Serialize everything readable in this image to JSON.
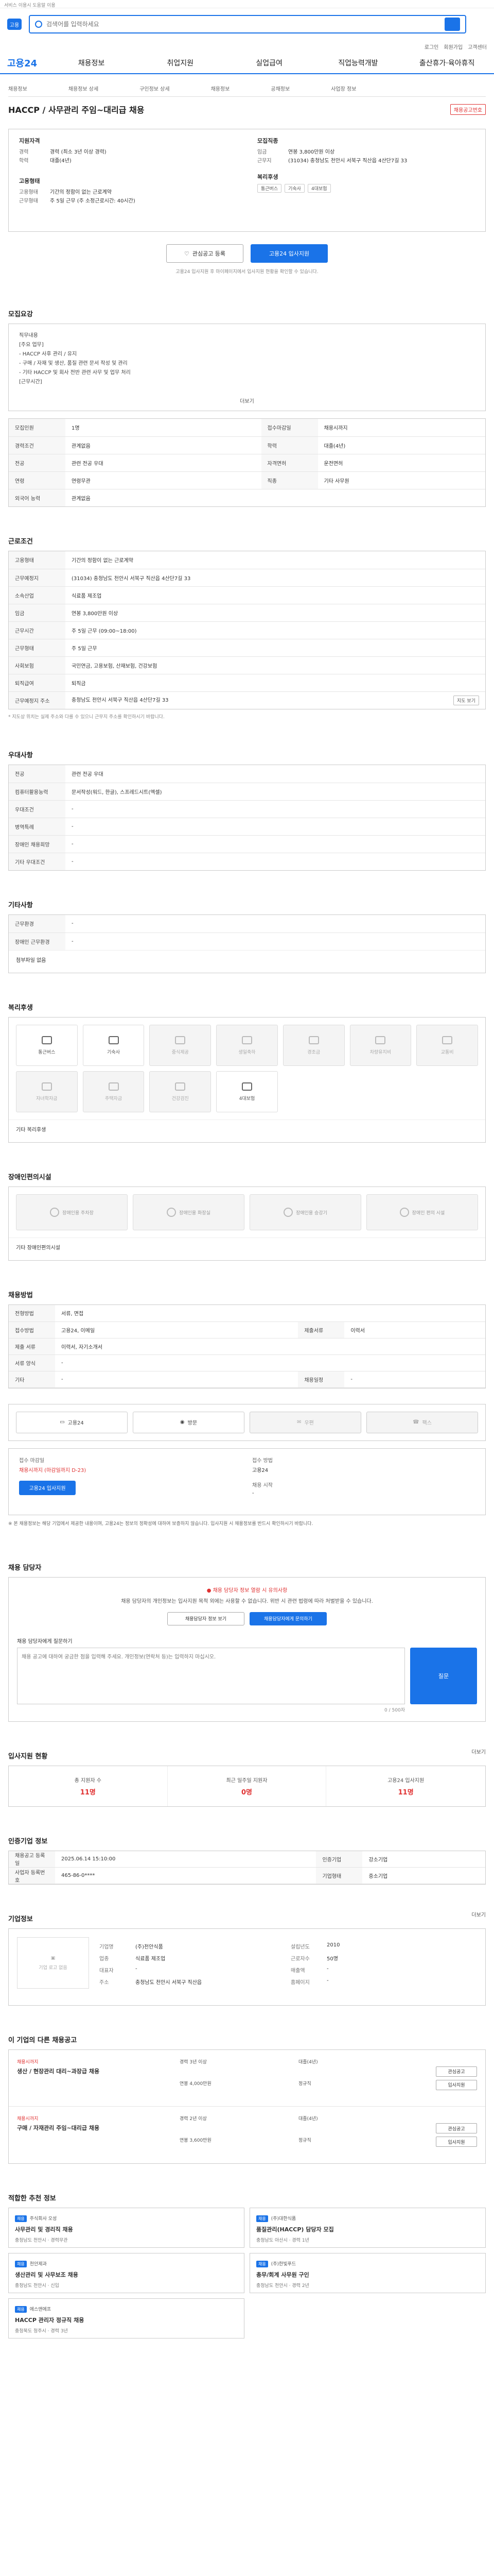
{
  "top": {
    "notice": "서비스 이용시 도움말 이용",
    "logo_text": "고용",
    "search_placeholder": "검색어를 입력하세요",
    "util_links": [
      "로그인",
      "회원가입",
      "고객센터"
    ]
  },
  "gnb": {
    "logo": "고용24",
    "items": [
      "채용정보",
      "취업지원",
      "실업급여",
      "직업능력개발",
      "출산휴가·육아휴직"
    ]
  },
  "breadcrumb": [
    "채용정보",
    "채용정보 상세",
    "구인정보 상세",
    "채용정보",
    "공채정보",
    "사업장 정보"
  ],
  "title": "HACCP / 사무관리 주임~대리급 채용",
  "scrap_badge": "채용공고번호",
  "summary": {
    "left_title": "지원자격",
    "left_rows": [
      {
        "k": "경력",
        "v": "경력 (최소 3년 이상 경력)"
      },
      {
        "k": "학력",
        "v": "대졸(4년)"
      }
    ],
    "cond_title": "고용형태",
    "cond_rows": [
      {
        "k": "고용형태",
        "v": "기간의 정함이 없는 근로계약"
      },
      {
        "k": "근무형태",
        "v": "주 5일 근무 (주 소정근로시간: 40시간)"
      }
    ],
    "right_title": "모집직종",
    "right_rows": [
      {
        "k": "임금",
        "v": "연봉 3,800만원 이상"
      },
      {
        "k": "근무지",
        "v": "(31034) 충청남도 천안시 서북구 직산읍 4산단7길 33"
      }
    ],
    "welfare_title": "복리후생",
    "chips": [
      "통근버스",
      "기숙사",
      "4대보험"
    ]
  },
  "actions": {
    "interest": "관심공고 등록",
    "apply": "고용24 입사지원",
    "note": "고용24 입사지원 후 마이페이지에서 입사지원 현황을 확인할 수 있습니다."
  },
  "sections": {
    "recruit": "모집요강",
    "work_cond": "근로조건",
    "pref": "우대사항",
    "etc": "기타사항",
    "welfare": "복리후생",
    "disability": "장애인편의시설",
    "method": "채용방법",
    "qa": "채용 담당자",
    "stats": "입사지원 현황",
    "hire": "인증기업 정보",
    "company": "기업정보",
    "other": "이 기업의 다른 채용공고",
    "recommend": "적합한 추천 정보"
  },
  "recruit": {
    "intro_lines": [
      "직무내용",
      "[주요 업무]",
      "- HACCP 사후 관리 / 유지",
      "- 구매 / 자재 및 생산, 품질 관련 문서 작성 및 관리",
      "- 기타 HACCP 및 회사 전반 관련 사무 및 업무 처리",
      "[근무시간]"
    ],
    "more": "더보기",
    "rows": [
      [
        "모집인원",
        "1명",
        "접수마감일",
        "채용시까지"
      ],
      [
        "경력조건",
        "관계없음",
        "학력",
        "대졸(4년)"
      ],
      [
        "전공",
        "관련 전공 우대",
        "자격면허",
        "운전면허"
      ],
      [
        "연령",
        "연령무관",
        "직종",
        "기타 사무원"
      ],
      [
        "외국어 능력",
        "관계없음",
        "",
        ""
      ]
    ]
  },
  "work": {
    "rows": [
      [
        "고용형태",
        "기간의 정함이 없는 근로계약"
      ],
      [
        "근무예정지",
        "(31034) 충청남도 천안시 서북구 직산읍 4산단7길 33"
      ],
      [
        "소속산업",
        "식료품 제조업"
      ],
      [
        "임금",
        "연봉 3,800만원 이상"
      ],
      [
        "근무시간",
        "주 5일 근무 (09:00~18:00)"
      ],
      [
        "근무형태",
        "주 5일 근무"
      ],
      [
        "사회보험",
        "국민연금, 고용보험, 산재보험, 건강보험"
      ],
      [
        "퇴직급여",
        "퇴직금"
      ],
      [
        "근무예정지 주소",
        "충청남도 천안시 서북구 직산읍 4산단7길 33"
      ]
    ],
    "map_btn": "지도 보기",
    "note": "* 지도상 위치는 실제 주소와 다를 수 있으니 근무지 주소를 확인하시기 바랍니다."
  },
  "pref_rows": [
    [
      "전공",
      "관련 전공 우대"
    ],
    [
      "컴퓨터활용능력",
      "문서작성(워드, 한글), 스프레드시트(엑셀)"
    ],
    [
      "우대조건",
      "-"
    ],
    [
      "병역특례",
      "-"
    ],
    [
      "장애인 채용희망",
      "-"
    ],
    [
      "기타 우대조건",
      "-"
    ]
  ],
  "etc_rows": [
    [
      "근무환경",
      "-"
    ],
    [
      "장애인 근무환경",
      "-"
    ]
  ],
  "etc_attach": "첨부파일 없음",
  "welfare": {
    "items": [
      {
        "label": "통근버스",
        "on": true
      },
      {
        "label": "기숙사",
        "on": true
      },
      {
        "label": "중식제공",
        "on": false
      },
      {
        "label": "생일축하",
        "on": false
      },
      {
        "label": "경조금",
        "on": false
      },
      {
        "label": "차량유지비",
        "on": false
      },
      {
        "label": "교통비",
        "on": false
      },
      {
        "label": "자녀학자금",
        "on": false
      },
      {
        "label": "주택자금",
        "on": false
      },
      {
        "label": "건강검진",
        "on": false
      },
      {
        "label": "4대보험",
        "on": true
      }
    ],
    "etc": "기타 복리후생"
  },
  "disability": {
    "items": [
      "장애인용 주차장",
      "장애인용 화장실",
      "장애인용 승강기",
      "장애인 편의 시설"
    ],
    "note": "기타 장애인편의시설"
  },
  "method_rows": [
    [
      "전형방법",
      "서류, 면접",
      "",
      ""
    ],
    [
      "접수방법",
      "고용24, 이메일",
      "제출서류",
      "이력서"
    ],
    [
      "제출 서류",
      "이력서, 자기소개서",
      "",
      ""
    ],
    [
      "서류 양식",
      "-",
      "",
      ""
    ],
    [
      "기타",
      "-",
      "채용일정",
      "-"
    ]
  ],
  "apply_methods": [
    "고용24",
    "방문",
    "우편",
    "팩스"
  ],
  "apply_info": {
    "deadline_lbl": "접수 마감일",
    "deadline": "채용시까지 (마감일까지 D-23)",
    "apply_btn": "고용24 입사지원",
    "period_lbl": "접수 방법",
    "period": "고용24",
    "contact_lbl": "채용 시작",
    "contact": "-"
  },
  "caution": "※ 본 채용정보는 해당 기업에서 제공한 내용이며, 고용24는 정보의 정확성에 대하여 보증하지 않습니다. 입사지원 시 채용정보를 반드시 확인하시기 바랍니다.",
  "qa": {
    "warn": "채용 담당자 정보 열람 시 유의사항",
    "desc": "채용 담당자의 개인정보는 입사지원 목적 외에는 사용할 수 없습니다. 위반 시 관련 법령에 따라 처벌받을 수 있습니다.",
    "btn1": "채용담당자 정보 보기",
    "btn2": "채용담당자에게 문의하기",
    "form_lbl": "채용 담당자에게 질문하기",
    "placeholder": "채용 공고에 대하여 궁금한 점을 입력해 주세요. 개인정보(연락처 등)는 입력하지 마십시오.",
    "send": "질문",
    "count": "0 / 500자"
  },
  "stats": [
    {
      "label": "총 지원자 수",
      "value": "11명"
    },
    {
      "label": "최근 일주일 지원자",
      "value": "0명"
    },
    {
      "label": "고용24 입사지원",
      "value": "11명"
    }
  ],
  "stats_more": "더보기",
  "hire_rows": [
    [
      "채용공고 등록일",
      "2025.06.14 15:10:00",
      "인증기업",
      "강소기업"
    ],
    [
      "사업자 등록번호",
      "465-86-0****",
      "기업형태",
      "중소기업"
    ]
  ],
  "company": {
    "logo_alt": "기업 로고 없음",
    "rows": [
      [
        "기업명",
        "(주)천안식품",
        "설립년도",
        "2010"
      ],
      [
        "업종",
        "식료품 제조업",
        "근로자수",
        "50명"
      ],
      [
        "대표자",
        "-",
        "매출액",
        "-"
      ],
      [
        "주소",
        "충청남도 천안시 서북구 직산읍",
        "홈페이지",
        "-"
      ]
    ],
    "more": "더보기"
  },
  "other_jobs": [
    {
      "tag": "채용시까지",
      "name": "생산 / 현장관리 대리~과장급 채용",
      "meta": [
        "경력 3년 이상",
        "대졸(4년)",
        "연봉 4,000만원",
        "정규직"
      ],
      "btns": [
        "관심공고",
        "입사지원"
      ]
    },
    {
      "tag": "채용시까지",
      "name": "구매 / 자재관리 주임~대리급 채용",
      "meta": [
        "경력 2년 이상",
        "대졸(4년)",
        "연봉 3,600만원",
        "정규직"
      ],
      "btns": [
        "관심공고",
        "입사지원"
      ]
    }
  ],
  "recommend": [
    {
      "tag": "채용",
      "co": "주식회사 오성",
      "title": "사무관리 및 경리직 채용",
      "meta": "충청남도 천안시 · 경력무관"
    },
    {
      "tag": "채용",
      "co": "(주)대한식품",
      "title": "품질관리(HACCP) 담당자 모집",
      "meta": "충청남도 아산시 · 경력 1년"
    },
    {
      "tag": "채용",
      "co": "천안제과",
      "title": "생산관리 및 사무보조 채용",
      "meta": "충청남도 천안시 · 신입"
    },
    {
      "tag": "채용",
      "co": "(주)한빛푸드",
      "title": "총무/회계 사무원 구인",
      "meta": "충청남도 천안시 · 경력 2년"
    },
    {
      "tag": "채용",
      "co": "에스앤에프",
      "title": "HACCP 관리자 정규직 채용",
      "meta": "충청북도 청주시 · 경력 3년"
    }
  ]
}
